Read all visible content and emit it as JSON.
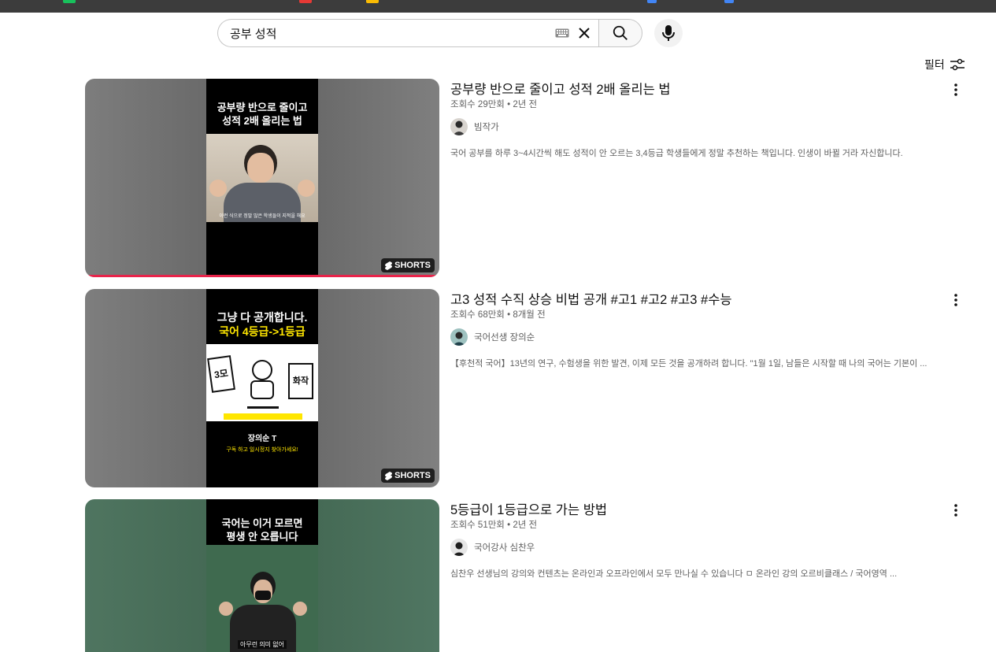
{
  "search": {
    "query": "공부 성적"
  },
  "filter": {
    "label": "필터"
  },
  "results": [
    {
      "title": "공부량 반으로 줄이고 성적 2배 올리는 법",
      "views": "조회수 29만회",
      "age": "2년 전",
      "channel": "빔작가",
      "description": "국어 공부를 하루 3~4시간씩 해도 성적이 안 오르는 3,4등급 학생들에게 정말 추천하는 책입니다. 인생이 바뀔 거라 자신합니다.",
      "thumb_caption": "공부량 반으로 줄이고\n성적 2배 올리는 법",
      "thumb_subtitle": "이런 식으로 정말 많은 학생들이 지적을 해요",
      "badge": "SHORTS",
      "watched_fraction": 1.0
    },
    {
      "title": "고3 성적 수직 상승 비법 공개 #고1 #고2 #고3 #수능",
      "views": "조회수 68만회",
      "age": "8개월 전",
      "channel": "국어선생 장의순",
      "description": "【후천적 국어】13년의 연구, 수험생을 위한 발견, 이제 모든 것을 공개하려 합니다. \"1월 1일, 남들은 시작할 때 나의 국어는 기본이 ...",
      "thumb_caption_1": "그냥 다 공개합니다.",
      "thumb_caption_2": "국어 4등급->1등급",
      "thumb_label_left": "3모",
      "thumb_label_right": "화작",
      "thumb_name": "장의순 T",
      "thumb_sub": "구독 하고 일시정지 찾아가세요!",
      "badge": "SHORTS"
    },
    {
      "title": "5등급이 1등급으로 가는 방법",
      "views": "조회수 51만회",
      "age": "2년 전",
      "channel": "국어강사 심찬우",
      "description": "심찬우 선생님의 강의와 컨텐츠는 온라인과 오프라인에서 모두 만나실 수 있습니다 ㅁ 온라인 강의 오르비클래스 / 국어영역 ...",
      "thumb_caption": "국어는 이거 모르면\n평생 안 오릅니다",
      "thumb_subtitle": "아무런 의미 없어"
    }
  ],
  "colors": {
    "progress": "#e8234a",
    "accent_yellow": "#ffe600"
  }
}
